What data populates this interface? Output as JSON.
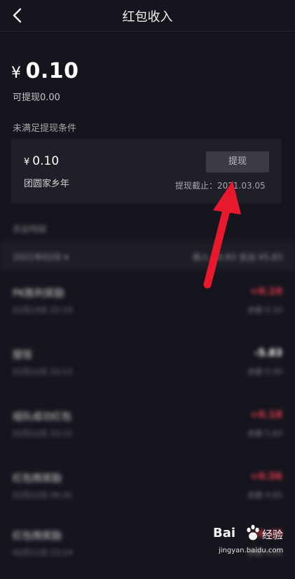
{
  "header": {
    "title": "红包收入",
    "back_icon": "chevron-left-icon"
  },
  "balance": {
    "currency": "¥",
    "amount": "0.10",
    "withdrawable": "可提现0.00"
  },
  "condition": {
    "label": "未满足提现条件"
  },
  "card": {
    "currency": "¥",
    "amount": "0.10",
    "name": "团圆家乡年",
    "button_label": "提现",
    "deadline": "提现截止：2021.03.05"
  },
  "details": {
    "section_label": "资金明细",
    "filter": {
      "month": "2021年02月 ▾",
      "summary": "收入 ¥0.83  支出 ¥5.83"
    },
    "rows": [
      {
        "name": "PK胜利奖励",
        "time": "02月14日 22:19",
        "amount": "+0.10",
        "balance": "余额 0.10",
        "sign": "pos"
      },
      {
        "name": "提现",
        "time": "02月12日 23:13",
        "amount": "-5.83",
        "balance": "余额 0.00",
        "sign": "neg"
      },
      {
        "name": "组队成功红包",
        "time": "02月12日 23:12",
        "amount": "+0.18",
        "balance": "余额 5.83",
        "sign": "pos"
      },
      {
        "name": "红包雨奖励",
        "time": "02月12日 00:31",
        "amount": "+0.56",
        "balance": "余额 4.65",
        "sign": "pos"
      },
      {
        "name": "红包雨奖励",
        "time": "02月11日 23:14",
        "amount": "+0.15",
        "balance": "余额 4.09",
        "sign": "pos"
      }
    ]
  },
  "annotation": {
    "color": "#e8192c"
  },
  "watermark": {
    "brand": "Bai",
    "jingyan": "经验",
    "url": "jingyan.baidu.com"
  }
}
